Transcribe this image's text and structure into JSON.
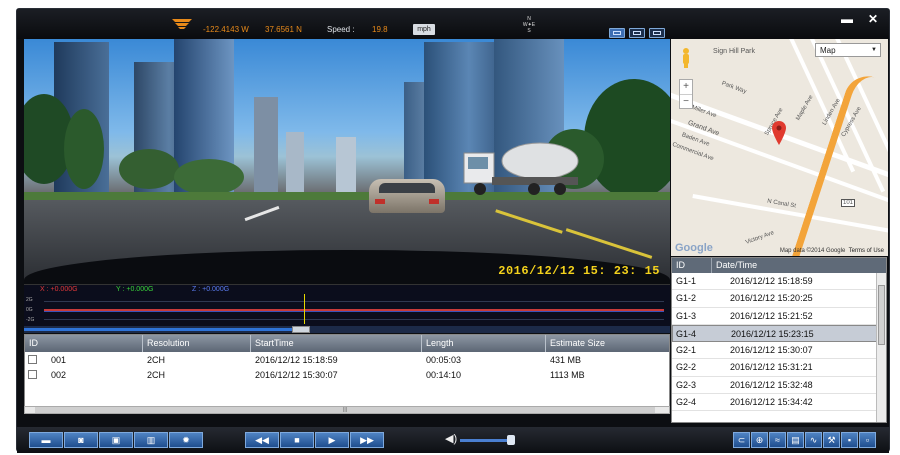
{
  "topbar": {
    "longitude": "-122.4143 W",
    "latitude": "37.6561 N",
    "speed_label": "Speed :",
    "speed_value": "19.8",
    "speed_unit": "mph",
    "minimize_glyph": "▬",
    "close_glyph": "✕"
  },
  "video": {
    "timestamp": "2016/12/12   15: 23: 15"
  },
  "gsensor": {
    "x_label": "X : +0.000G",
    "y_label": "Y : +0.000G",
    "z_label": "Z : +0.000G",
    "scale": [
      "2G",
      "0G",
      "-2G"
    ]
  },
  "filelist": {
    "columns": [
      "ID",
      "Resolution",
      "StartTime",
      "Length",
      "Estimate Size"
    ],
    "rows": [
      {
        "id": "001",
        "resolution": "2CH",
        "start": "2016/12/12 15:18:59",
        "length": "00:05:03",
        "size": "431 MB"
      },
      {
        "id": "002",
        "resolution": "2CH",
        "start": "2016/12/12 15:30:07",
        "length": "00:14:10",
        "size": "1113 MB"
      }
    ]
  },
  "map": {
    "type_select": "Map",
    "zoom_in": "+",
    "zoom_out": "−",
    "streets": [
      "Sign Hill Park",
      "Park Way",
      "Miller Ave",
      "Grand Ave",
      "Baden Ave",
      "Commercial Ave",
      "Spruce Ave",
      "Maple Ave",
      "Linden Ave",
      "Cypress Ave",
      "N Canal St",
      "Victory Ave",
      "101"
    ],
    "logo": "Google",
    "copyright": "Map data ©2014 Google",
    "terms": "Terms of Use"
  },
  "gpslist": {
    "columns": [
      "ID",
      "Date/Time"
    ],
    "rows": [
      {
        "id": "G1-1",
        "time": "2016/12/12  15:18:59"
      },
      {
        "id": "G1-2",
        "time": "2016/12/12  15:20:25"
      },
      {
        "id": "G1-3",
        "time": "2016/12/12  15:21:52"
      },
      {
        "id": "G1-4",
        "time": "2016/12/12  15:23:15"
      },
      {
        "id": "G2-1",
        "time": "2016/12/12  15:30:07"
      },
      {
        "id": "G2-2",
        "time": "2016/12/12  15:31:21"
      },
      {
        "id": "G2-3",
        "time": "2016/12/12  15:32:48"
      },
      {
        "id": "G2-4",
        "time": "2016/12/12  15:34:42"
      }
    ],
    "selected_index": 3
  },
  "controls": {
    "rewind": "◀◀",
    "stop": "■",
    "play": "▶",
    "forward": "▶▶",
    "volume_level": 0.9
  },
  "colors": {
    "accent": "#e88a1a",
    "timestamp": "#f4d21c",
    "button_blue": "#2f63a8"
  }
}
